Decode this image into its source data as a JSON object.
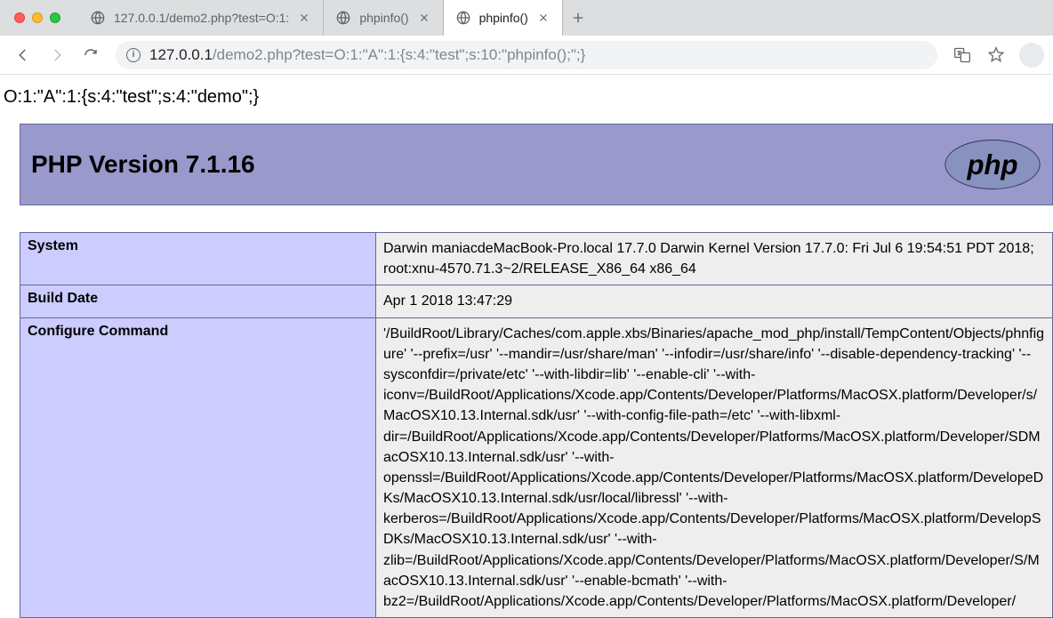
{
  "browser": {
    "tabs": [
      {
        "title": "127.0.0.1/demo2.php?test=O:1:",
        "active": false
      },
      {
        "title": "phpinfo()",
        "active": false
      },
      {
        "title": "phpinfo()",
        "active": true
      }
    ],
    "url_host": "127.0.0.1",
    "url_path": "/demo2.php?test=O:1:\"A\":1:{s:4:\"test\";s:10:\"phpinfo();\";}"
  },
  "page": {
    "pretext": "O:1:\"A\":1:{s:4:\"test\";s:4:\"demo\";}",
    "php_version_title": "PHP Version 7.1.16",
    "rows": [
      {
        "key": "System",
        "value": "Darwin maniacdeMacBook-Pro.local 17.7.0 Darwin Kernel Version 17.7.0: Fri Jul 6 19:54:51 PDT 2018; root:xnu-4570.71.3~2/RELEASE_X86_64 x86_64"
      },
      {
        "key": "Build Date",
        "value": "Apr 1 2018 13:47:29"
      },
      {
        "key": "Configure Command",
        "value": "'/BuildRoot/Library/Caches/com.apple.xbs/Binaries/apache_mod_php/install/TempContent/Objects/phnfigure' '--prefix=/usr' '--mandir=/usr/share/man' '--infodir=/usr/share/info' '--disable-dependency-tracking' '--sysconfdir=/private/etc' '--with-libdir=lib' '--enable-cli' '--with-iconv=/BuildRoot/Applications/Xcode.app/Contents/Developer/Platforms/MacOSX.platform/Developer/s/MacOSX10.13.Internal.sdk/usr' '--with-config-file-path=/etc' '--with-libxml-dir=/BuildRoot/Applications/Xcode.app/Contents/Developer/Platforms/MacOSX.platform/Developer/SDMacOSX10.13.Internal.sdk/usr' '--with-openssl=/BuildRoot/Applications/Xcode.app/Contents/Developer/Platforms/MacOSX.platform/DevelopeDKs/MacOSX10.13.Internal.sdk/usr/local/libressl' '--with-kerberos=/BuildRoot/Applications/Xcode.app/Contents/Developer/Platforms/MacOSX.platform/DevelopSDKs/MacOSX10.13.Internal.sdk/usr' '--with-zlib=/BuildRoot/Applications/Xcode.app/Contents/Developer/Platforms/MacOSX.platform/Developer/S/MacOSX10.13.Internal.sdk/usr' '--enable-bcmath' '--with-bz2=/BuildRoot/Applications/Xcode.app/Contents/Developer/Platforms/MacOSX.platform/Developer/"
      }
    ]
  }
}
